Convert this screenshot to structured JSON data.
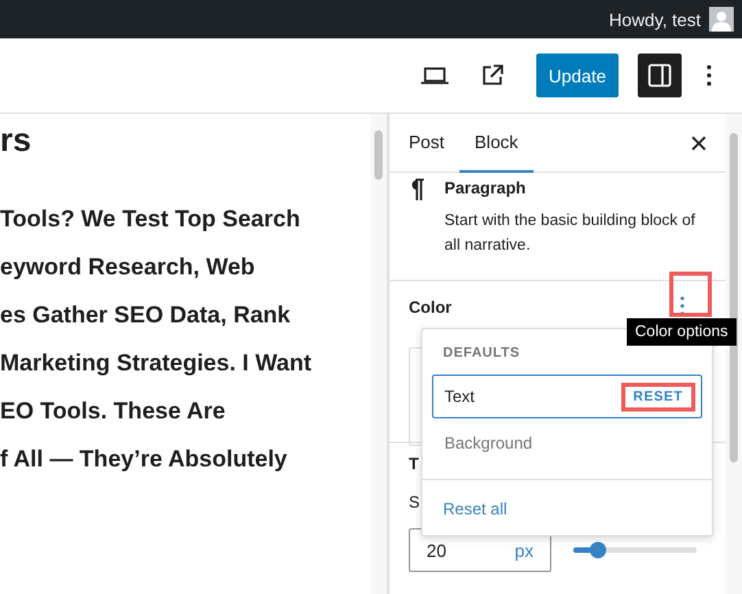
{
  "admin_bar": {
    "greeting": "Howdy, test"
  },
  "toolbar": {
    "primary_button": "Update",
    "settings_panel_open": true
  },
  "editor": {
    "heading": "rs",
    "lines": [
      "Tools? We Test Top Search",
      "eyword Research, Web",
      "es Gather SEO Data, Rank",
      "Marketing Strategies. I Want",
      "EO Tools. These Are",
      "f All — They’re Absolutely"
    ]
  },
  "sidebar": {
    "tabs": [
      {
        "label": "Post",
        "selected": false
      },
      {
        "label": "Block",
        "selected": true
      }
    ],
    "block": {
      "name": "Paragraph",
      "description": "Start with the basic building block of all narrative."
    },
    "color": {
      "heading": "Color",
      "tooltip": "Color options"
    },
    "typography_heading": "T",
    "size_label": "S",
    "font_size": {
      "value": "20",
      "unit": "px",
      "level": 0.2
    }
  },
  "color_menu": {
    "group_label": "DEFAULTS",
    "items": [
      {
        "label": "Text",
        "selected": true,
        "action": "RESET"
      },
      {
        "label": "Background",
        "selected": false
      }
    ],
    "reset_all": "Reset all"
  }
}
